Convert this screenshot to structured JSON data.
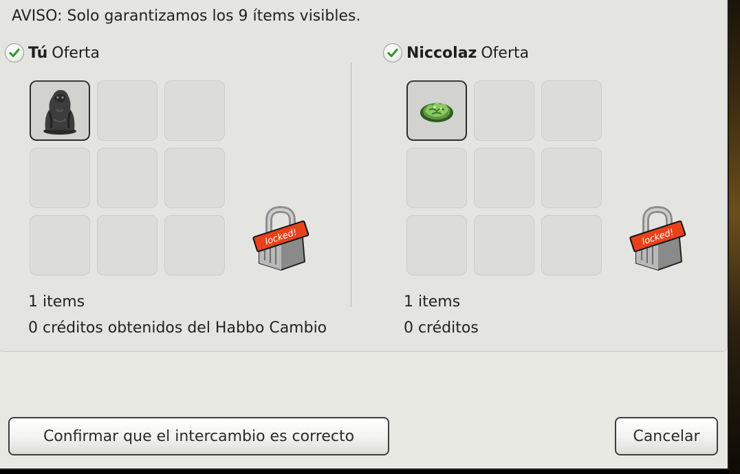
{
  "notice": "AVISO: Solo garantizamos los 9 ítems visibles.",
  "left_offer": {
    "name": "Tú",
    "suffix": "Oferta",
    "accepted": true,
    "items": [
      "gorilla-statue",
      "",
      "",
      "",
      "",
      "",
      "",
      "",
      ""
    ],
    "items_count": "1 items",
    "credits": "0 créditos obtenidos del Habbo Cambio",
    "lock_label": "locked!"
  },
  "right_offer": {
    "name": "Niccolaz",
    "suffix": "Oferta",
    "accepted": true,
    "items": [
      "cabbage-plant",
      "",
      "",
      "",
      "",
      "",
      "",
      "",
      ""
    ],
    "items_count": "1 items",
    "credits": "0 créditos",
    "lock_label": "locked!"
  },
  "buttons": {
    "confirm": "Confirmar que el intercambio es correcto",
    "cancel": "Cancelar"
  },
  "colors": {
    "check_green": "#2e9a2e",
    "lock_tag": "#e8421c"
  }
}
